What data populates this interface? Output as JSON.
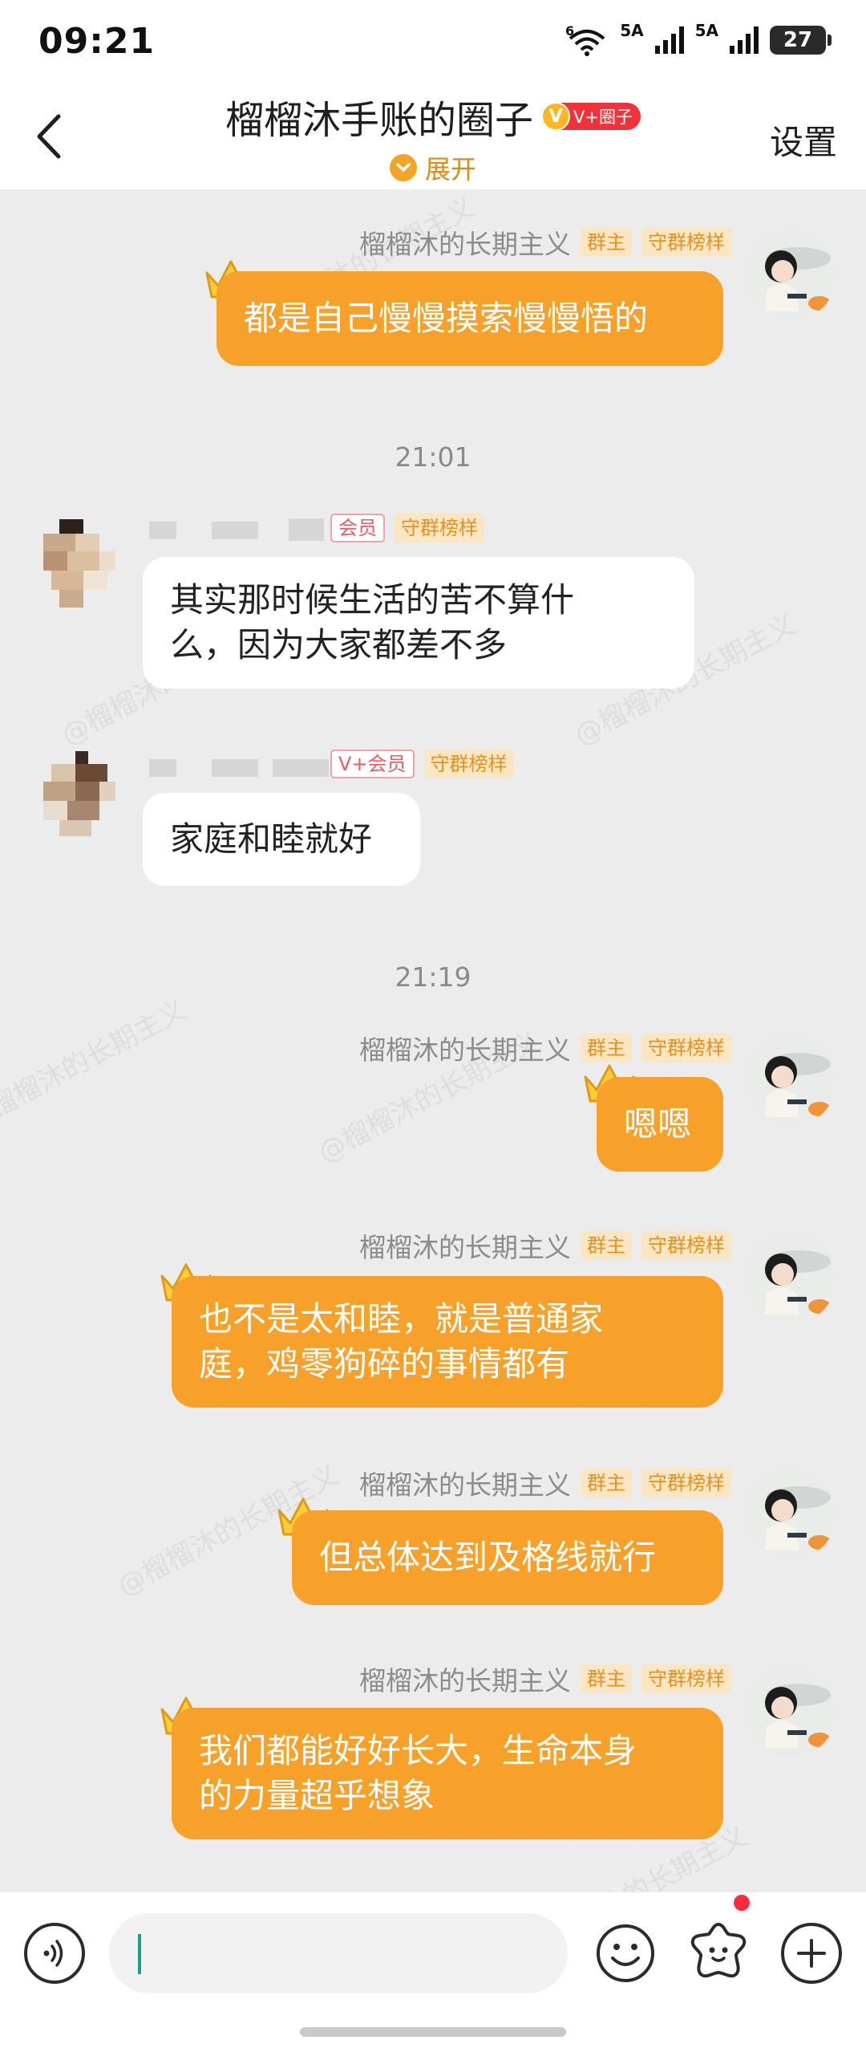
{
  "status_bar": {
    "time": "09:21",
    "signal1_label": "5A",
    "signal2_label": "5A",
    "battery": "27",
    "wifi_badge": "6"
  },
  "header": {
    "title": "榴榴沐手账的圈子",
    "badge_v": "V",
    "badge_text": "V+圈子",
    "expand_label": "展开",
    "settings_label": "设置"
  },
  "watermark_text": "@榴榴沐的长期主义",
  "messages": [
    {
      "sender": "榴榴沐的长期主义",
      "badges": [
        "群主",
        "守群榜样"
      ],
      "text": "都是自己慢慢摸索慢慢悟的"
    },
    {
      "timestamp": "21:01"
    },
    {
      "sender": "",
      "badges": [
        "会员",
        "守群榜样"
      ],
      "text": "其实那时候生活的苦不算什\n么，因为大家都差不多"
    },
    {
      "sender": "",
      "badges": [
        "V+会员",
        "守群榜样"
      ],
      "text": "家庭和睦就好"
    },
    {
      "timestamp": "21:19"
    },
    {
      "sender": "榴榴沐的长期主义",
      "badges": [
        "群主",
        "守群榜样"
      ],
      "text": "嗯嗯"
    },
    {
      "sender": "榴榴沐的长期主义",
      "badges": [
        "群主",
        "守群榜样"
      ],
      "text": "也不是太和睦，就是普通家\n庭，鸡零狗碎的事情都有"
    },
    {
      "sender": "榴榴沐的长期主义",
      "badges": [
        "群主",
        "守群榜样"
      ],
      "text": "但总体达到及格线就行"
    },
    {
      "sender": "榴榴沐的长期主义",
      "badges": [
        "群主",
        "守群榜样"
      ],
      "text": "我们都能好好长大，生命本身\n的力量超乎想象"
    }
  ],
  "input": {
    "placeholder": "",
    "value": ""
  },
  "icons": {
    "voice": "voice-icon",
    "emoji": "emoji-icon",
    "sticker": "sticker-icon",
    "plus": "plus-icon"
  },
  "colors": {
    "accent": "#f8a12a",
    "badge_bg": "#fbe6c3",
    "badge_text": "#e8901a"
  }
}
